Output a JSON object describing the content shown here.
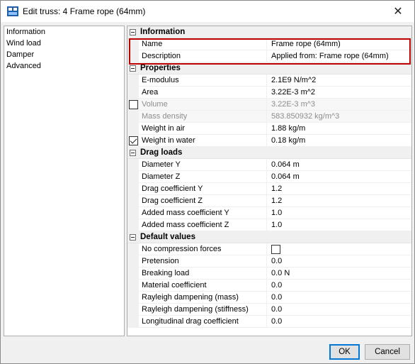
{
  "window": {
    "title": "Edit truss: 4 Frame rope (64mm)"
  },
  "sidebar": {
    "items": [
      {
        "label": "Information"
      },
      {
        "label": "Wind load"
      },
      {
        "label": "Damper"
      },
      {
        "label": "Advanced"
      }
    ]
  },
  "grid": {
    "information": {
      "label": "Information",
      "name": {
        "label": "Name",
        "value": "Frame rope (64mm)"
      },
      "description": {
        "label": "Description",
        "value": "Applied from: Frame rope (64mm)"
      }
    },
    "properties": {
      "label": "Properties",
      "e_modulus": {
        "label": "E-modulus",
        "value": "2.1E9 N/m^2"
      },
      "area": {
        "label": "Area",
        "value": "3.22E-3 m^2"
      },
      "volume": {
        "label": "Volume",
        "value": "3.22E-3 m^3",
        "checked": false
      },
      "mass_density": {
        "label": "Mass density",
        "value": "583.850932 kg/m^3"
      },
      "weight_in_air": {
        "label": "Weight in air",
        "value": "1.88 kg/m"
      },
      "weight_in_water": {
        "label": "Weight in water",
        "value": "0.18 kg/m",
        "checked": true
      }
    },
    "drag_loads": {
      "label": "Drag loads",
      "diameter_y": {
        "label": "Diameter Y",
        "value": "0.064 m"
      },
      "diameter_z": {
        "label": "Diameter Z",
        "value": "0.064 m"
      },
      "drag_coeff_y": {
        "label": "Drag coefficient Y",
        "value": "1.2"
      },
      "drag_coeff_z": {
        "label": "Drag coefficient Z",
        "value": "1.2"
      },
      "added_mass_y": {
        "label": "Added mass coefficient Y",
        "value": "1.0"
      },
      "added_mass_z": {
        "label": "Added mass coefficient Z",
        "value": "1.0"
      }
    },
    "default_values": {
      "label": "Default values",
      "no_compression": {
        "label": "No compression forces",
        "checked": false
      },
      "pretension": {
        "label": "Pretension",
        "value": "0.0"
      },
      "breaking_load": {
        "label": "Breaking load",
        "value": "0.0 N"
      },
      "material_coeff": {
        "label": "Material coefficient",
        "value": "0.0"
      },
      "rayleigh_mass": {
        "label": "Rayleigh dampening (mass)",
        "value": "0.0"
      },
      "rayleigh_stiffness": {
        "label": "Rayleigh dampening (stiffness)",
        "value": "0.0"
      },
      "longitudinal_drag": {
        "label": "Longitudinal drag coefficient",
        "value": "0.0"
      }
    }
  },
  "buttons": {
    "ok": "OK",
    "cancel": "Cancel"
  },
  "colors": {
    "highlight": "#c00000",
    "accent": "#0078d7"
  }
}
